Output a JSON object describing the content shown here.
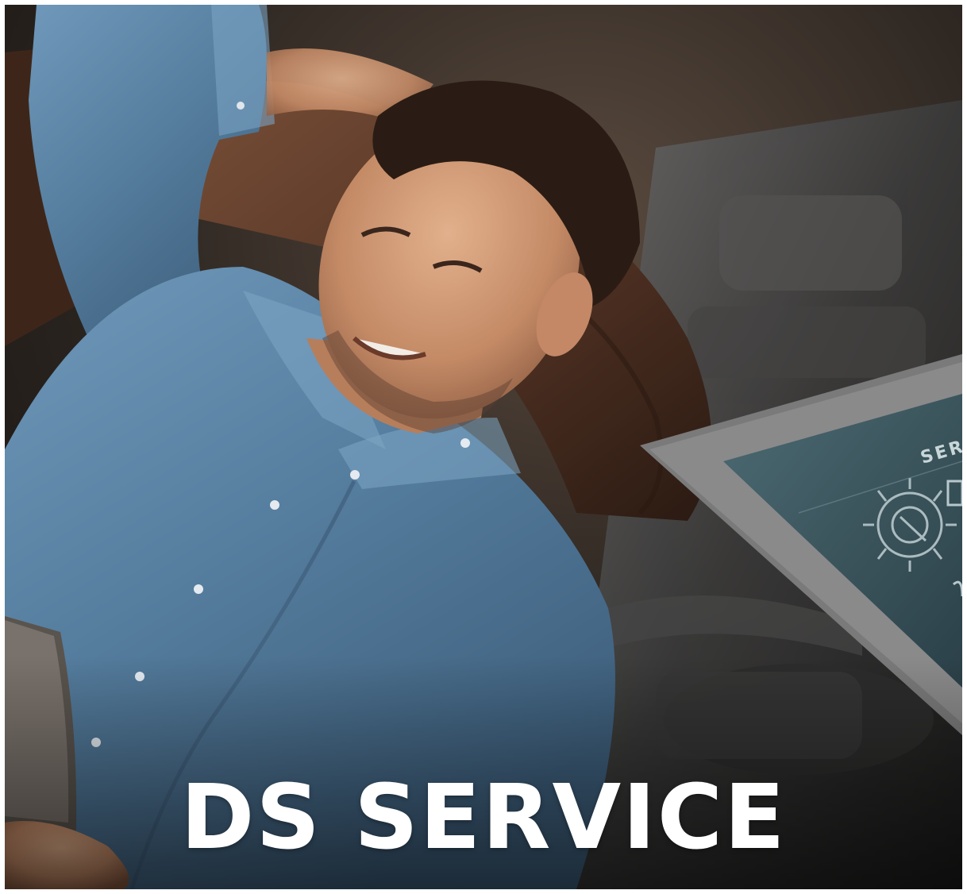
{
  "headline": "DS SERVICE",
  "tablet_screen_label": "SERV",
  "colors": {
    "headline": "#ffffff",
    "shirt": "#5f86a8",
    "sofa": "#5b3a28",
    "background": "#2a2521",
    "tablet_screen": "#3a5560"
  },
  "icons": [
    "gear-wrench-icon"
  ]
}
